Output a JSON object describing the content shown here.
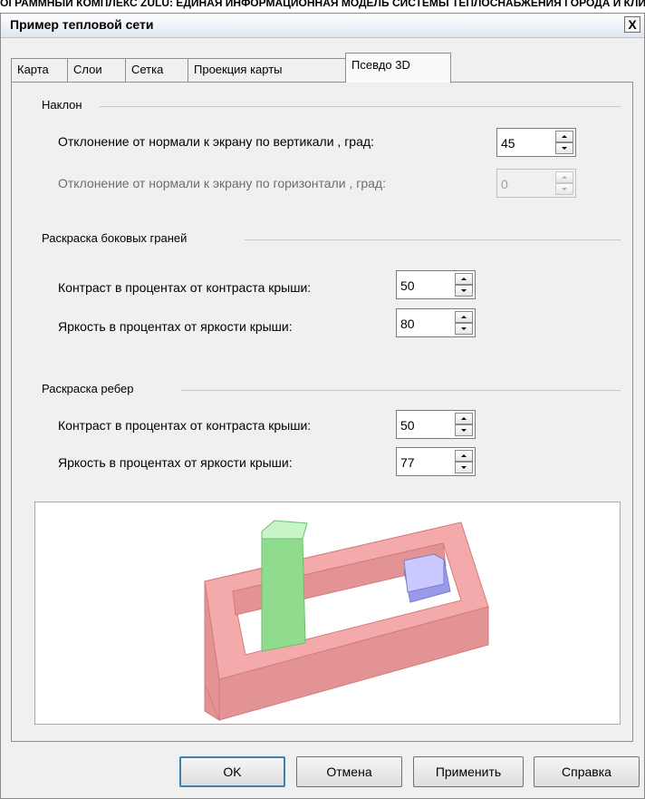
{
  "background_text": "ОГРАММНЫЙ КОМПЛЕКС ZULU: ЕДИНАЯ ИНФОРМАЦИОННАЯ МОДЕЛЬ СИСТЕМЫ ТЕПЛОСНАБЖЕНИЯ ГОРОДА И КЛИМАТИЧЕСК",
  "dialog": {
    "title": "Пример тепловой сети",
    "close_label": "X"
  },
  "tabs": [
    {
      "label": "Карта"
    },
    {
      "label": "Слои"
    },
    {
      "label": "Сетка"
    },
    {
      "label": "Проекция карты"
    },
    {
      "label": "Псевдо 3D",
      "active": true
    }
  ],
  "tilt": {
    "title": "Наклон",
    "vertical_label": "Отклонение от нормали к экрану по вертикали , град:",
    "vertical_value": "45",
    "horizontal_label": "Отклонение от нормали к экрану по горизонтали , град:",
    "horizontal_value": "0"
  },
  "side_faces": {
    "title": "Раскраска боковых граней",
    "contrast_label": "Контраст в процентах от контраста крыши:",
    "contrast_value": "50",
    "brightness_label": "Яркость в процентах от яркости крыши:",
    "brightness_value": "80"
  },
  "edges": {
    "title": "Раскраска ребер",
    "contrast_label": "Контраст в процентах от контраста крыши:",
    "contrast_value": "50",
    "brightness_label": "Яркость в процентах от яркости крыши:",
    "brightness_value": "77"
  },
  "preview": {
    "colors": {
      "ring_top": "#f4aaaa",
      "ring_side": "#e39393",
      "tower_top": "#c8f5c8",
      "tower_side": "#8fdc8f",
      "cube_top": "#c9c9ff",
      "cube_side": "#9a9aea"
    }
  },
  "buttons": {
    "ok": "OK",
    "cancel": "Отмена",
    "apply": "Применить",
    "help": "Справка"
  }
}
